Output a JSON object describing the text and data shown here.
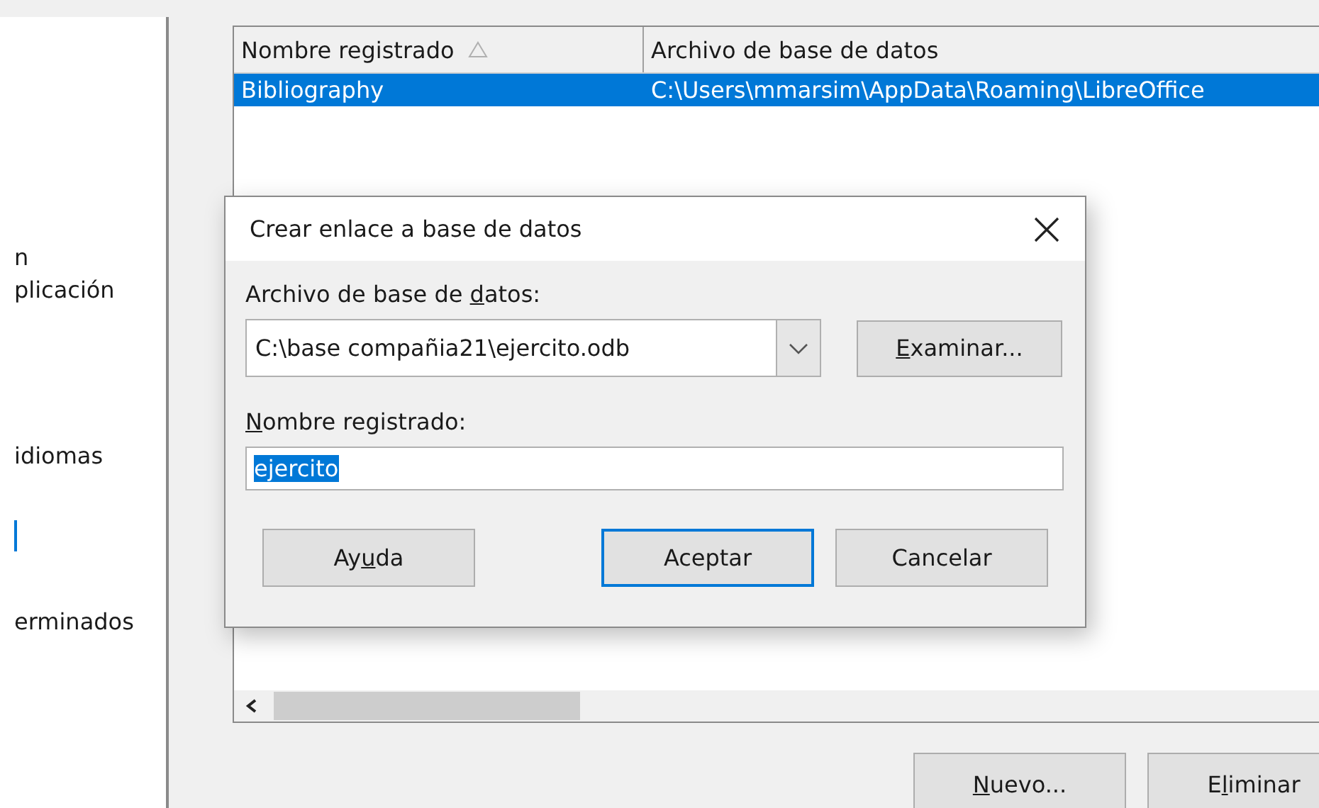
{
  "sidebar": {
    "items": [
      {
        "label": "n",
        "selected": false
      },
      {
        "label": "plicación",
        "selected": false
      },
      {
        "label": "idiomas",
        "selected": false
      },
      {
        "label": "erminados",
        "selected": false
      }
    ],
    "selection_marker": true
  },
  "table": {
    "columns": [
      {
        "label": "Nombre registrado",
        "sorted": true
      },
      {
        "label": "Archivo de base de datos",
        "sorted": false
      }
    ],
    "rows": [
      {
        "cells": [
          "Bibliography",
          "C:\\Users\\mmarsim\\AppData\\Roaming\\LibreOffice"
        ],
        "selected": true
      }
    ]
  },
  "buttons": [
    {
      "key": "N",
      "after": "uevo..."
    },
    {
      "before": "E",
      "key": "l",
      "after": "iminar"
    }
  ],
  "dialog": {
    "title": "Crear enlace a base de datos",
    "file_label": {
      "before": "Archivo de base de ",
      "key": "d",
      "after": "atos:"
    },
    "file_value": "C:\\base compañia21\\ejercito.odb",
    "browse_button": {
      "key": "E",
      "after": "xaminar..."
    },
    "name_label": {
      "key": "N",
      "after": "ombre registrado:"
    },
    "name_value": "ejercito",
    "name_value_selected": true,
    "buttons": [
      {
        "before": "Ay",
        "key": "u",
        "after": "da",
        "default": false,
        "kind": "help"
      },
      {
        "after": "Aceptar",
        "default": true,
        "kind": "ok"
      },
      {
        "after": "Cancelar",
        "default": false,
        "kind": "cancel"
      }
    ]
  }
}
